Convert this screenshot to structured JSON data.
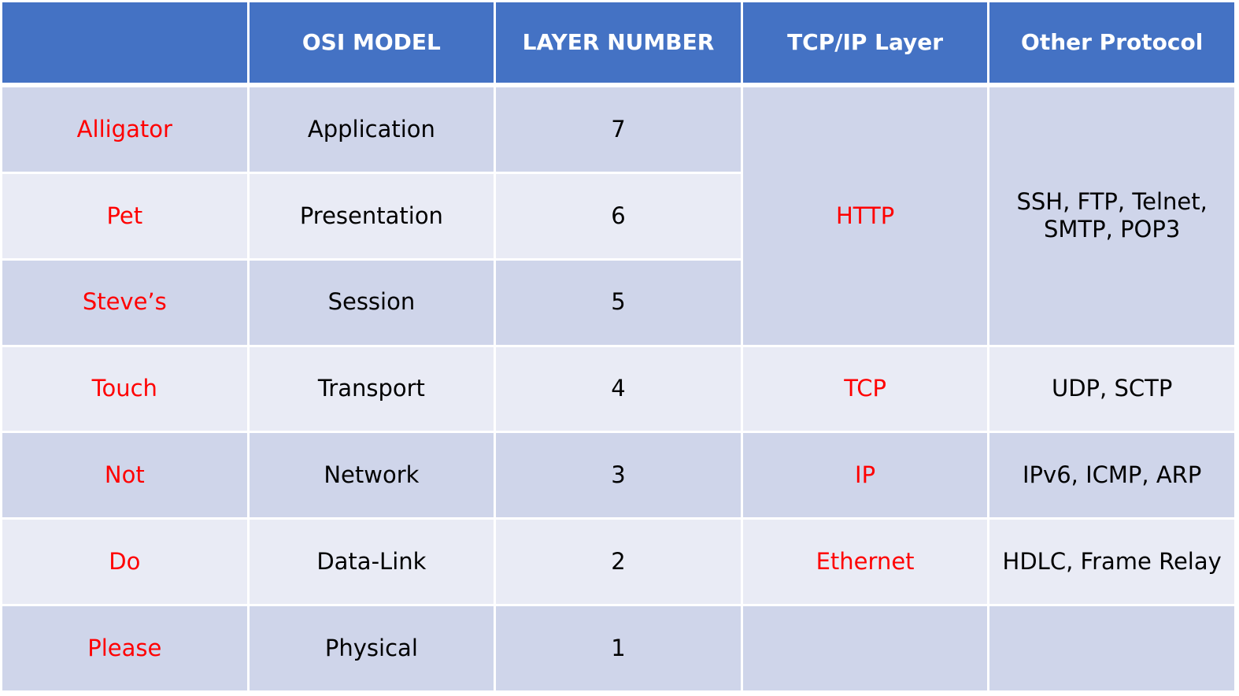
{
  "header": {
    "col1": "",
    "col2": "OSI MODEL",
    "col3": "LAYER NUMBER",
    "col4": "TCP/IP Layer",
    "col5": "Other Protocol"
  },
  "rows": [
    {
      "mnemonic": "Alligator",
      "osi": "Application",
      "number": "7"
    },
    {
      "mnemonic": "Pet",
      "osi": "Presentation",
      "number": "6"
    },
    {
      "mnemonic": "Steve’s",
      "osi": "Session",
      "number": "5"
    },
    {
      "mnemonic": "Touch",
      "osi": "Transport",
      "number": "4"
    },
    {
      "mnemonic": "Not",
      "osi": "Network",
      "number": "3"
    },
    {
      "mnemonic": "Do",
      "osi": "Data-Link",
      "number": "2"
    },
    {
      "mnemonic": "Please",
      "osi": "Physical",
      "number": "1"
    }
  ],
  "tcpip": {
    "upper": "HTTP",
    "transport": "TCP",
    "network": "IP",
    "datalink": "Ethernet",
    "physical": ""
  },
  "other": {
    "upper_line1": "SSH, FTP, Telnet,",
    "upper_line2": "SMTP, POP3",
    "transport": "UDP, SCTP",
    "network": "IPv6, ICMP, ARP",
    "datalink": "HDLC, Frame Relay",
    "physical": ""
  },
  "colors": {
    "header_bg": "#4472C4",
    "row_dark": "#CFD5EA",
    "row_light": "#E9EBF5",
    "highlight_text": "#FF0000"
  }
}
